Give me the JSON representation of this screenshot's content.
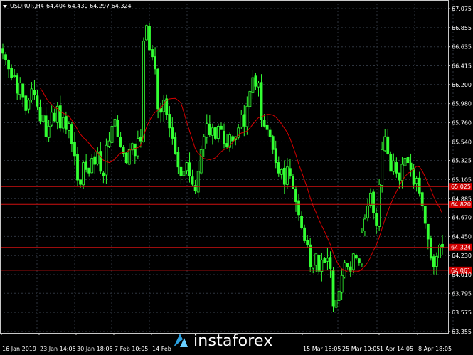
{
  "header": {
    "title": "USDRUR,H4",
    "ohlc": "64.404 64.430 64.297 64.324"
  },
  "colors": {
    "background": "#000000",
    "grid": "#2f3640",
    "frame": "#c8c8c8",
    "bull": "#33ff33",
    "bear": "#33ff33",
    "ma": "#d60000",
    "level_line": "#d01010",
    "level_label_bg": "#d00000"
  },
  "watermark": {
    "text": "instaforex",
    "logo": "instaforex-logo"
  },
  "chart_data": {
    "type": "candlestick",
    "symbol": "USDRUR",
    "timeframe": "H4",
    "grid": true,
    "ylim": [
      63.355,
      67.12
    ],
    "y_ticks": [
      "67.075",
      "66.855",
      "66.635",
      "66.415",
      "66.200",
      "65.980",
      "65.760",
      "65.540",
      "65.325",
      "65.105",
      "64.885",
      "64.670",
      "64.450",
      "64.230",
      "64.010",
      "63.795",
      "63.575",
      "63.355"
    ],
    "x_ticks": [
      "16 Jan 2019",
      "23 Jan 14:05",
      "30 Jan 18:05",
      "7 Feb 10:05",
      "14 Feb",
      "15 Mar 18:05",
      "25 Mar 10:05",
      "1 Apr 14:05",
      "8 Apr 18:05"
    ],
    "levels": [
      {
        "value": 65.025,
        "label": "65.025"
      },
      {
        "value": 64.82,
        "label": "64.820"
      },
      {
        "value": 64.324,
        "label": "64.324"
      },
      {
        "value": 64.061,
        "label": "64.061"
      }
    ],
    "close": [
      66.56,
      66.48,
      66.38,
      66.28,
      66.3,
      66.1,
      66.22,
      66.05,
      65.9,
      66.02,
      66.15,
      66.08,
      65.95,
      65.78,
      65.85,
      65.6,
      65.72,
      65.88,
      65.78,
      65.95,
      65.7,
      65.82,
      65.68,
      65.75,
      65.52,
      65.38,
      65.1,
      65.05,
      65.3,
      65.22,
      65.18,
      65.35,
      65.28,
      65.42,
      65.2,
      65.15,
      65.5,
      65.55,
      65.72,
      65.8,
      65.6,
      65.48,
      65.4,
      65.3,
      65.45,
      65.52,
      65.38,
      65.58,
      65.55,
      66.7,
      66.88,
      66.6,
      66.52,
      66.38,
      65.92,
      65.88,
      66.02,
      65.85,
      65.7,
      65.58,
      65.4,
      65.25,
      65.15,
      65.2,
      65.3,
      65.15,
      65.05,
      64.98,
      65.2,
      65.45,
      65.6,
      65.75,
      65.62,
      65.7,
      65.58,
      65.72,
      65.68,
      65.52,
      65.48,
      65.62,
      65.55,
      65.6,
      65.7,
      65.85,
      65.72,
      65.95,
      66.12,
      66.28,
      66.18,
      66.22,
      65.8,
      65.72,
      65.68,
      65.6,
      65.45,
      65.3,
      65.18,
      65.22,
      65.05,
      65.25,
      65.15,
      65.0,
      64.85,
      64.7,
      64.55,
      64.4,
      64.35,
      64.1,
      64.12,
      64.25,
      64.05,
      64.18,
      64.15,
      64.2,
      64.08,
      63.65,
      63.72,
      63.82,
      64.0,
      64.15,
      64.1,
      64.05,
      64.25,
      64.2,
      64.15,
      64.5,
      64.65,
      64.8,
      64.95,
      64.72,
      64.58,
      65.05,
      65.45,
      65.6,
      65.4,
      65.2,
      65.32,
      65.18,
      65.1,
      65.28,
      65.35,
      65.3,
      65.22,
      65.05,
      65.12,
      64.95,
      64.8,
      64.6,
      64.42,
      64.2,
      64.1,
      64.22,
      64.35,
      64.32
    ],
    "ma_period": 14
  }
}
